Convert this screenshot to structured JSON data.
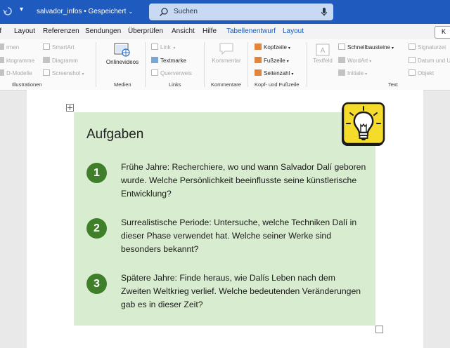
{
  "titlebar": {
    "doc_title": "salvador_infos • Gespeichert",
    "search_placeholder": "Suchen"
  },
  "menu_tabs": [
    {
      "label": "rf"
    },
    {
      "label": "Layout"
    },
    {
      "label": "Referenzen"
    },
    {
      "label": "Sendungen"
    },
    {
      "label": "Überprüfen"
    },
    {
      "label": "Ansicht"
    },
    {
      "label": "Hilfe"
    },
    {
      "label": "Tabellenentwurf"
    },
    {
      "label": "Layout"
    }
  ],
  "menu_right_label": "K",
  "ribbon": {
    "illustrations": {
      "label": "Illustrationen",
      "items": [
        "rmen",
        "ktogramme",
        "D-Modelle"
      ],
      "items2": [
        "SmartArt",
        "Diagramm",
        "Screenshot"
      ]
    },
    "media": {
      "label": "Medien",
      "button": "Onlinevideos"
    },
    "links": {
      "label": "Links",
      "items": [
        "Link",
        "Textmarke",
        "Querverweis"
      ]
    },
    "comments": {
      "label": "Kommentare",
      "button": "Kommentar"
    },
    "header_footer": {
      "label": "Kopf- und Fußzeile",
      "items": [
        "Kopfzeile",
        "Fußzeile",
        "Seitenzahl"
      ]
    },
    "text": {
      "label": "Text",
      "textfield": "Textfeld",
      "items": [
        "Schnellbausteine",
        "WordArt",
        "Initiale"
      ],
      "items2": [
        "Signaturzei",
        "Datum und U",
        "Objekt"
      ]
    }
  },
  "document": {
    "box_title": "Aufgaben",
    "tasks": [
      {
        "num": "1",
        "text": "Frühe Jahre: Recherchiere, wo und wann Salvador Dalí geboren wurde. Welche Persönlichkeit beeinflusste seine künstlerische Entwicklung?"
      },
      {
        "num": "2",
        "text": "Surrealistische Periode: Untersuche, welche Techniken Dalí in dieser Phase verwendet hat. Welche seiner Werke sind besonders bekannt?"
      },
      {
        "num": "3",
        "text": "Spätere Jahre: Finde heraus, wie Dalís Leben nach dem Zweiten Weltkrieg verlief. Welche bedeutenden Veränderungen gab es in dieser Zeit?"
      }
    ]
  },
  "colors": {
    "titlebar": "#1f5bbf",
    "accent_tab": "#185abd",
    "box_background": "#d8edcf",
    "number_circle": "#3f7f2a",
    "bulb_background": "#f5dc2a"
  }
}
